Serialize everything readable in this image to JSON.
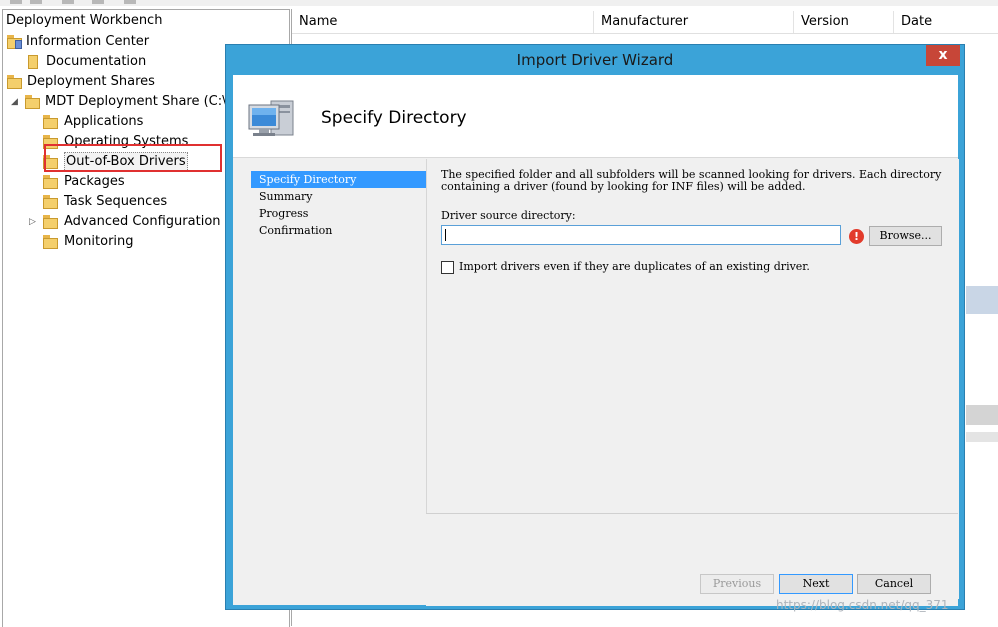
{
  "tree": {
    "root": "Deployment Workbench",
    "info_center": "Information Center",
    "documentation": "Documentation",
    "deployment_shares": "Deployment Shares",
    "mdt_share": "MDT Deployment Share (C:\\De",
    "applications": "Applications",
    "operating_systems": "Operating Systems",
    "drivers": "Out-of-Box Drivers",
    "packages": "Packages",
    "task_sequences": "Task Sequences",
    "advanced_config": "Advanced Configuration",
    "monitoring": "Monitoring"
  },
  "list": {
    "columns": [
      "Name",
      "Manufacturer",
      "Version",
      "Date"
    ]
  },
  "dialog": {
    "title": "Import Driver Wizard",
    "close": "x",
    "header_title": "Specify Directory",
    "steps": [
      "Specify Directory",
      "Summary",
      "Progress",
      "Confirmation"
    ],
    "description": "The specified folder and all subfolders will be scanned looking for drivers.  Each directory containing a driver (found by looking for INF files) will be added.",
    "source_label": "Driver source directory:",
    "source_value": "",
    "error_icon": "!",
    "browse": "Browse...",
    "checkbox_label": "Import drivers even if they are duplicates of an existing driver.",
    "checkbox_checked": false,
    "previous": "Previous",
    "next": "Next",
    "cancel": "Cancel"
  },
  "watermark": "https://blog.csdn.net/qq_371",
  "colors": {
    "dialog_frame": "#3ba3d8",
    "close": "#c74638",
    "highlight": "#e03030",
    "selection": "#3399ff"
  }
}
